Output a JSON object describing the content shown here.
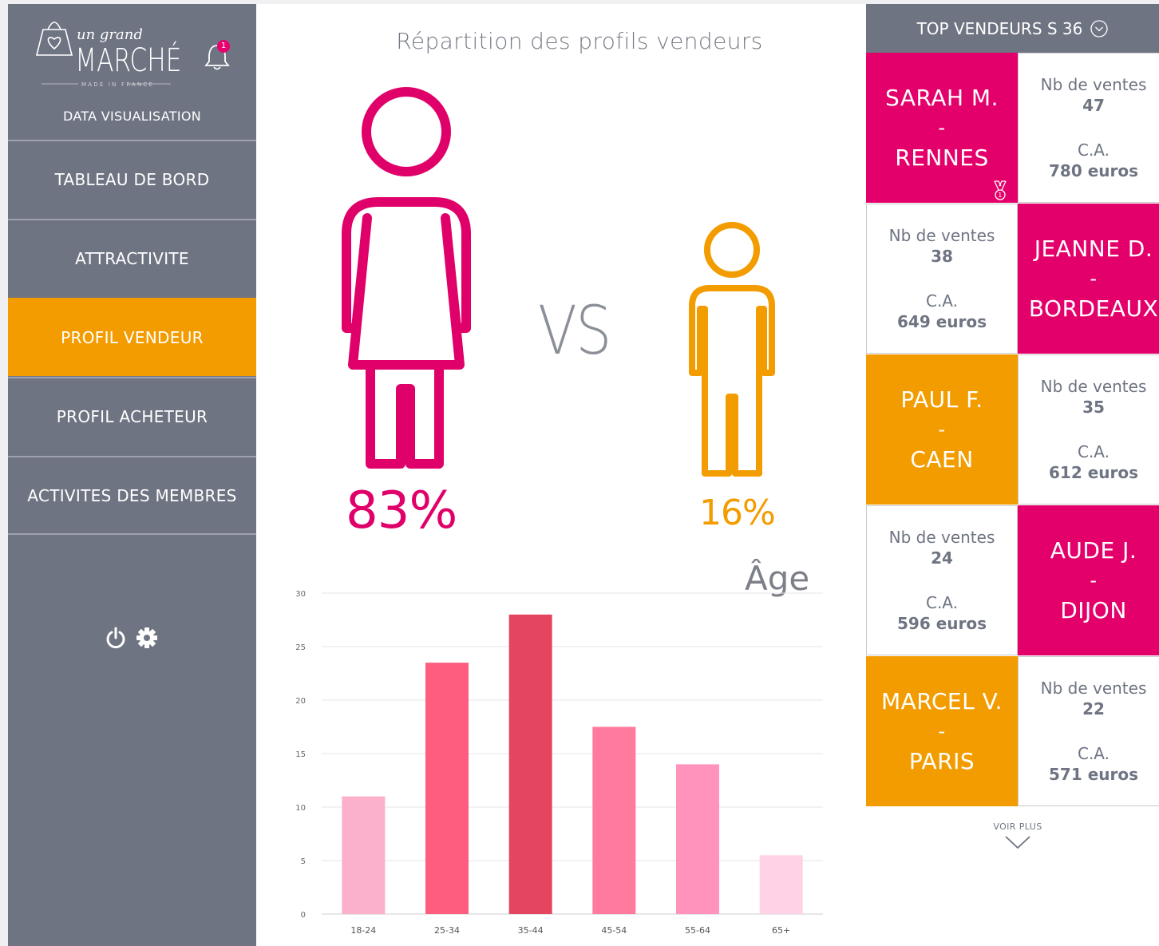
{
  "sidebar": {
    "logo": {
      "line1": "un grand",
      "line2": "MARCHÉ",
      "line3": "MADE IN FRANCE"
    },
    "notification_count": "1",
    "subtitle": "DATA VISUALISATION",
    "items": [
      {
        "label": "TABLEAU DE BORD",
        "active": false
      },
      {
        "label": "ATTRACTIVITE",
        "active": false
      },
      {
        "label": "PROFIL VENDEUR",
        "active": true
      },
      {
        "label": "PROFIL ACHETEUR",
        "active": false
      },
      {
        "label": "ACTIVITES DES MEMBRES",
        "active": false
      }
    ],
    "footer_icons": [
      "power-icon",
      "gear-icon"
    ]
  },
  "main": {
    "title": "Répartition des profils vendeurs",
    "vs": "VS",
    "women_pct": "83%",
    "child_pct": "16%",
    "age_title": "Âge",
    "colors": {
      "women": "#e0006a",
      "child": "#f39c00"
    }
  },
  "chart_data": {
    "type": "bar",
    "categories": [
      "18-24",
      "25-34",
      "35-44",
      "45-54",
      "55-64",
      "65+"
    ],
    "values": [
      11,
      23.5,
      28,
      17.5,
      14,
      5.5
    ],
    "colors": [
      "#fbb0cc",
      "#ff5d80",
      "#e3465e",
      "#ff7a9c",
      "#ff93bb",
      "#ffd2e6"
    ],
    "ylim": [
      0,
      30
    ],
    "yticks": [
      0,
      5,
      10,
      15,
      20,
      25,
      30
    ],
    "grid": true,
    "title": "Âge"
  },
  "top_sellers": {
    "header": "TOP VENDEURS S 36",
    "sales_label": "Nb de ventes",
    "ca_label": "C.A.",
    "dash": "-",
    "sellers": [
      {
        "name": "SARAH M.",
        "city": "RENNES",
        "sales": "47",
        "ca": "780 euros",
        "color": "pink"
      },
      {
        "name": "JEANNE D.",
        "city": "BORDEAUX",
        "sales": "38",
        "ca": "649 euros",
        "color": "pink"
      },
      {
        "name": "PAUL F.",
        "city": "CAEN",
        "sales": "35",
        "ca": "612 euros",
        "color": "orange"
      },
      {
        "name": "AUDE J.",
        "city": "DIJON",
        "sales": "24",
        "ca": "596 euros",
        "color": "pink"
      },
      {
        "name": "MARCEL V.",
        "city": "PARIS",
        "sales": "22",
        "ca": "571 euros",
        "color": "orange"
      }
    ],
    "more_label": "VOIR PLUS"
  }
}
